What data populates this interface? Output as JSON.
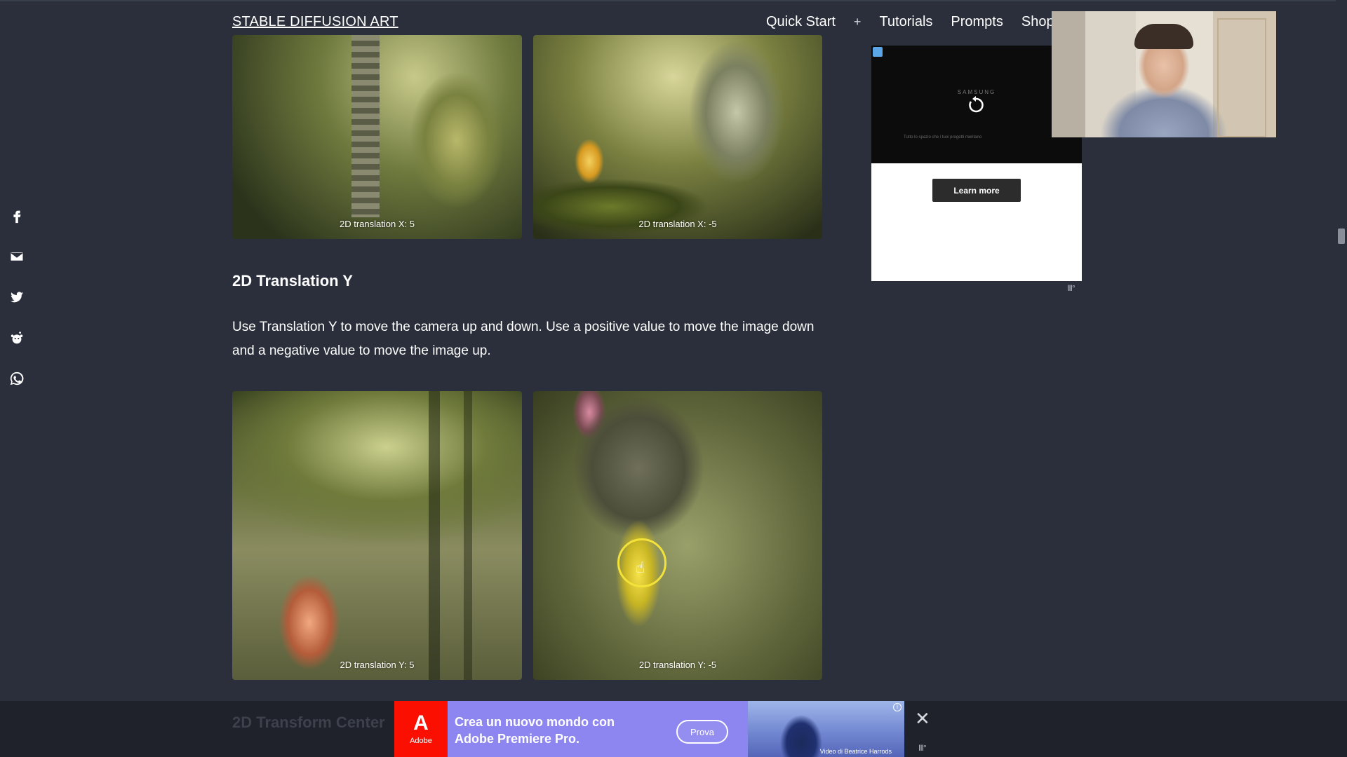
{
  "header": {
    "site_title": "STABLE DIFFUSION ART",
    "nav": {
      "quick_start": "Quick Start",
      "plus": "+",
      "tutorials": "Tutorials",
      "prompts": "Prompts",
      "shop": "Shop"
    }
  },
  "share": [
    "facebook-icon",
    "email-icon",
    "twitter-icon",
    "reddit-icon",
    "whatsapp-icon"
  ],
  "gallery_x": [
    {
      "caption": "2D translation X: 5"
    },
    {
      "caption": "2D translation X: -5"
    }
  ],
  "section": {
    "title": "2D Translation Y",
    "text": "Use Translation Y to move the camera up and down. Use a positive value to move the image down and a negative value to move the image up."
  },
  "gallery_y": [
    {
      "caption": "2D translation Y: 5"
    },
    {
      "caption": "2D translation Y: -5"
    }
  ],
  "next_section_title": "2D Transform Center",
  "side_ad": {
    "brand": "SAMSUNG",
    "fine_print": "Tutto lo spazio che i tuoi progetti meritano",
    "learn_more": "Learn more",
    "mark": "III°"
  },
  "bottom_banner": {
    "logo_letter": "A",
    "logo_word": "Adobe",
    "line1": "Crea un nuovo mondo con",
    "line2": "Adobe Premiere Pro.",
    "cta": "Prova",
    "credit": "Video di Beatrice Harrods",
    "info": "i",
    "close": "✕",
    "mark": "III°"
  },
  "colors": {
    "background": "#2b2f3b",
    "text": "#ffffff",
    "cursor_ring": "#f3e23a",
    "banner": "#8d85f0",
    "adobe_red": "#fa0f00"
  }
}
